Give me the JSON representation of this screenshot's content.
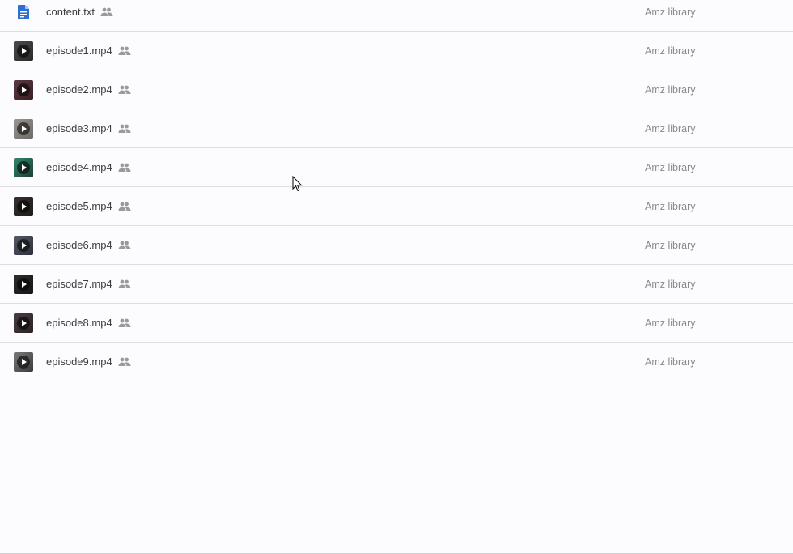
{
  "files": [
    {
      "name": "content.txt",
      "location": "Amz library",
      "type": "doc",
      "icon": "text-doc-icon",
      "thumb_colors": [
        "#2f6ed3",
        "#2f6ed3"
      ]
    },
    {
      "name": "episode1.mp4",
      "location": "Amz library",
      "type": "video",
      "icon": "video-play-icon",
      "thumb_colors": [
        "#2a2a2a",
        "#4a4a4a"
      ]
    },
    {
      "name": "episode2.mp4",
      "location": "Amz library",
      "type": "video",
      "icon": "video-play-icon",
      "thumb_colors": [
        "#3a1f25",
        "#5b3a42"
      ]
    },
    {
      "name": "episode3.mp4",
      "location": "Amz library",
      "type": "video",
      "icon": "video-play-icon",
      "thumb_colors": [
        "#6e6a66",
        "#9a9590"
      ]
    },
    {
      "name": "episode4.mp4",
      "location": "Amz library",
      "type": "video",
      "icon": "video-play-icon",
      "thumb_colors": [
        "#1f3a3a",
        "#2f8a6a"
      ]
    },
    {
      "name": "episode5.mp4",
      "location": "Amz library",
      "type": "video",
      "icon": "video-play-icon",
      "thumb_colors": [
        "#1c1c1c",
        "#3a3030"
      ]
    },
    {
      "name": "episode6.mp4",
      "location": "Amz library",
      "type": "video",
      "icon": "video-play-icon",
      "thumb_colors": [
        "#2c2f38",
        "#555a66"
      ]
    },
    {
      "name": "episode7.mp4",
      "location": "Amz library",
      "type": "video",
      "icon": "video-play-icon",
      "thumb_colors": [
        "#151515",
        "#2d2d2d"
      ]
    },
    {
      "name": "episode8.mp4",
      "location": "Amz library",
      "type": "video",
      "icon": "video-play-icon",
      "thumb_colors": [
        "#2a2226",
        "#4a3d42"
      ]
    },
    {
      "name": "episode9.mp4",
      "location": "Amz library",
      "type": "video",
      "icon": "video-play-icon",
      "thumb_colors": [
        "#3a3a3a",
        "#7a7a7a"
      ]
    }
  ],
  "shared_icon": "people-shared-icon",
  "colors": {
    "text": "#3c3c3c",
    "secondary_text": "#8a8a8a",
    "divider": "#dedde1",
    "background": "#fcfbfe",
    "doc_blue": "#2f6ed3"
  }
}
